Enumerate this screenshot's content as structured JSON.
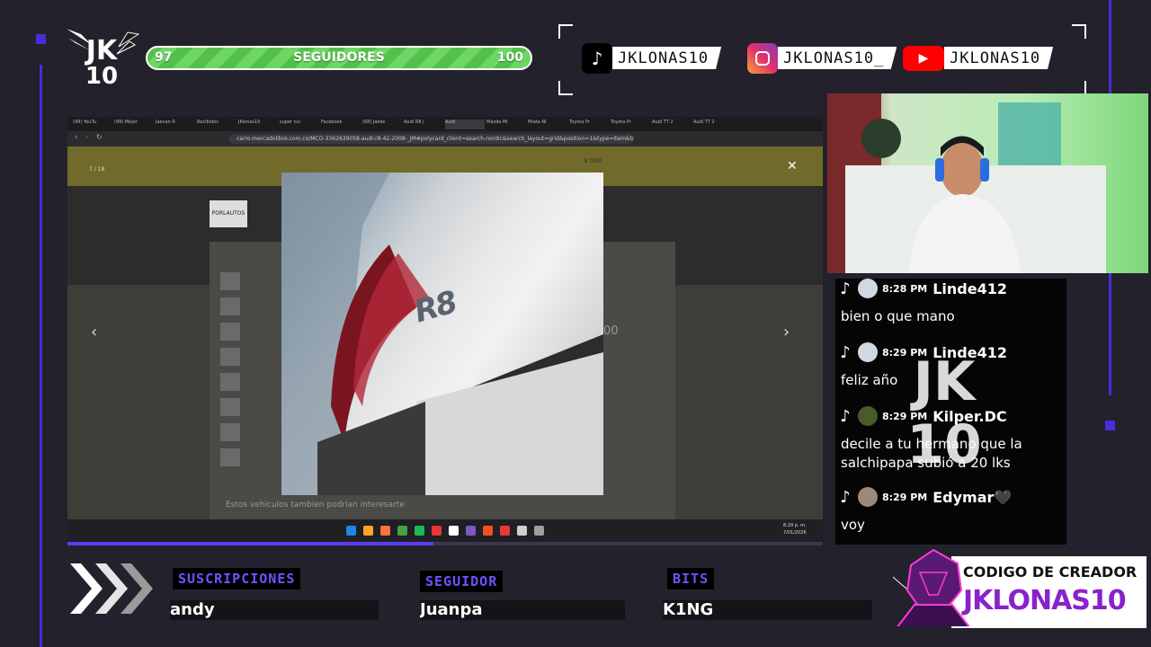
{
  "logo": {
    "line1": "JK",
    "line2": "10"
  },
  "followers": {
    "current": "97",
    "label": "SEGUIDORES",
    "goal": "100",
    "progress": 0.97
  },
  "socials": [
    {
      "icon": "tiktok-icon",
      "handle": "JKLONAS10"
    },
    {
      "icon": "instagram-icon",
      "handle": "JKLONAS10_"
    },
    {
      "icon": "youtube-icon",
      "handle": "JKLONAS10"
    }
  ],
  "browser": {
    "tabs": [
      "(99) YouTu",
      "(99) Mejor",
      "Jaevan R",
      "Recibidos",
      "JKlonas10",
      "super cui",
      "Facebook",
      "(68) Jaeke",
      "Audi R8 |",
      "Audi",
      "Mazda Mi",
      "Miata Ni",
      "Toyota Pr",
      "Toyota Pr",
      "Audi TT 2",
      "Audi TT 2"
    ],
    "url": "carro.mercadolibre.com.co/MCO-3362639058-audi-r8-42-2008-_JM#polycard_client=search-nordic&search_layout=grid&position=1&type=item&tr...",
    "counter": "7 / 18",
    "seller": "PORLAUTOS",
    "price_fragment": "00",
    "price_fragment2": "9.000",
    "similar_text": "Estos vehiculos tambien podrian interesarte",
    "clock_time": "8:29 p. m.",
    "clock_date": "7/01/2026",
    "emblem": "R8",
    "tab_counter_label": "Audi"
  },
  "chat": [
    {
      "time": "8:28 PM",
      "user": "Linde412",
      "text": "bien o que mano"
    },
    {
      "time": "8:29 PM",
      "user": "Linde412",
      "text": "feliz año"
    },
    {
      "time": "8:29 PM",
      "user": "Kilper.DC",
      "text": "decile a tu hermano que la salchipapa subió a 20 lks"
    },
    {
      "time": "8:29 PM",
      "user": "Edymar🖤",
      "text": "voy"
    }
  ],
  "bottom": {
    "subs_label": "SUSCRIPCIONES",
    "subs_name": "andy",
    "follower_label": "SEGUIDOR",
    "follower_name": "Juanpa",
    "bits_label": "BITS",
    "bits_name": "K1NG"
  },
  "creator": {
    "title": "CODIGO DE CREADOR",
    "code": "JKLONAS10"
  },
  "colors": {
    "accent": "#4b2bdc",
    "bar_green": "#53c04c",
    "bg": "#23212b"
  }
}
